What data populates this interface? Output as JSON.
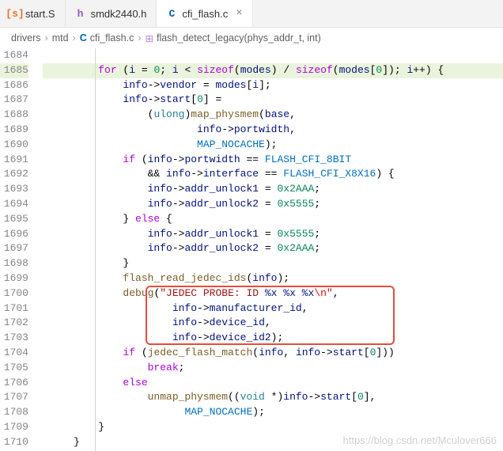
{
  "tabs": [
    {
      "icon": "[s]",
      "label": "start.S",
      "active": false
    },
    {
      "icon": "h",
      "label": "smdk2440.h",
      "active": false
    },
    {
      "icon": "C",
      "label": "cfi_flash.c",
      "active": true
    }
  ],
  "breadcrumbs": {
    "parts": [
      "drivers",
      "mtd",
      "cfi_flash.c",
      "flash_detect_legacy(phys_addr_t, int)"
    ],
    "fileIcon": "C",
    "fnIcon": "⊞"
  },
  "lines": {
    "start": 1684,
    "end": 1710
  },
  "code": {
    "l1685": {
      "kw1": "for",
      "v1": "i",
      "n0": "0",
      "v2": "i",
      "kw2": "sizeof",
      "v3": "modes",
      "kw3": "sizeof",
      "v4": "modes",
      "n1": "0",
      "v5": "i"
    },
    "l1686": {
      "v": "info",
      "p": "vendor",
      "v2": "modes",
      "v3": "i"
    },
    "l1687": {
      "v": "info",
      "p": "start",
      "n": "0"
    },
    "l1688": {
      "t": "ulong",
      "f": "map_physmem",
      "v": "base"
    },
    "l1689": {
      "v": "info",
      "p": "portwidth"
    },
    "l1690": {
      "c": "MAP_NOCACHE"
    },
    "l1691": {
      "kw": "if",
      "v": "info",
      "p": "portwidth",
      "c": "FLASH_CFI_8BIT"
    },
    "l1692": {
      "v": "info",
      "p": "interface",
      "c": "FLASH_CFI_X8X16"
    },
    "l1693": {
      "v": "info",
      "p": "addr_unlock1",
      "n": "0x2AAA"
    },
    "l1694": {
      "v": "info",
      "p": "addr_unlock2",
      "n": "0x5555"
    },
    "l1695": {
      "kw": "else"
    },
    "l1696": {
      "v": "info",
      "p": "addr_unlock1",
      "n": "0x5555"
    },
    "l1697": {
      "v": "info",
      "p": "addr_unlock2",
      "n": "0x2AAA"
    },
    "l1699": {
      "f": "flash_read_jedec_ids",
      "v": "info"
    },
    "l1700": {
      "f": "debug",
      "s1": "\"JEDEC PROBE: ID ",
      "fmt": "%x %x %x",
      "esc": "\\n",
      "s2": "\""
    },
    "l1701": {
      "v": "info",
      "p": "manufacturer_id"
    },
    "l1702": {
      "v": "info",
      "p": "device_id"
    },
    "l1703": {
      "v": "info",
      "p": "device_id2"
    },
    "l1704": {
      "kw": "if",
      "f": "jedec_flash_match",
      "v": "info",
      "v2": "info",
      "p": "start",
      "n": "0"
    },
    "l1705": {
      "kw": "break"
    },
    "l1706": {
      "kw": "else"
    },
    "l1707": {
      "f": "unmap_physmem",
      "t": "void",
      "v": "info",
      "p": "start",
      "n": "0"
    },
    "l1708": {
      "c": "MAP_NOCACHE"
    }
  },
  "watermark": "https://blog.csdn.net/Mculover666"
}
